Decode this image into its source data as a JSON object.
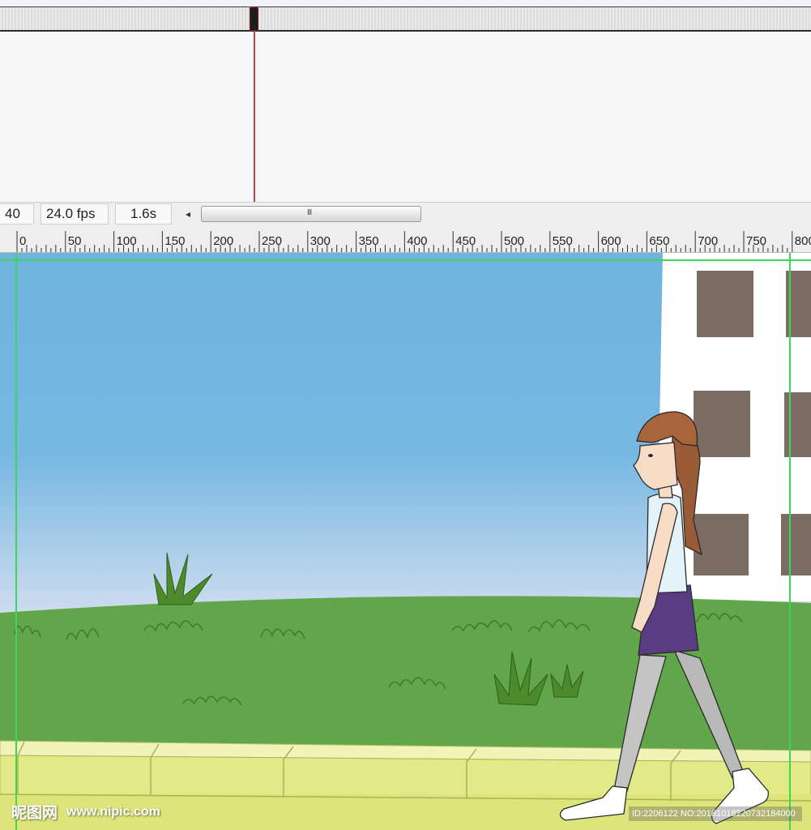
{
  "timeline": {
    "frame": "40",
    "fps": "24.0 fps",
    "time": "1.6s"
  },
  "ruler": {
    "ticks": [
      "0",
      "50",
      "100",
      "150",
      "200",
      "250",
      "300",
      "350",
      "400",
      "450",
      "500",
      "550",
      "600",
      "650",
      "700",
      "750",
      "800"
    ]
  },
  "stage": {
    "sky_top_color": "#6fb3e0",
    "sky_bottom_color": "#ece8f0",
    "grass_color": "#61a64a",
    "sidewalk_color": "#e2e987",
    "building_color": "#ffffff",
    "window_color": "#7b6d64",
    "guide_color": "#3ed65a"
  },
  "watermark": {
    "logo": "昵图网",
    "url": "www.nipic.com",
    "id": "ID:2206122 NO:20181018220732184000"
  }
}
